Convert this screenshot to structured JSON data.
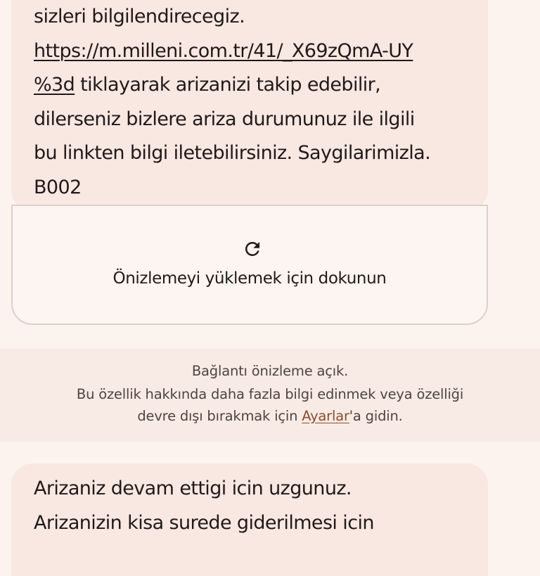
{
  "message_top": {
    "lines_before_link": [
      "sizleri bilgilendirecegiz."
    ],
    "link_part1": "https://m.milleni.com.tr/41/_X69zQmA-UY",
    "link_part2": "%3d",
    "after_link": " tiklayarak arizanizi takip edebilir,",
    "lines_after": [
      "dilerseniz bizlere ariza durumunuz ile ilgili",
      "bu linkten bilgi iletebilirsiniz.  Saygilarimizla.",
      "B002"
    ]
  },
  "preview": {
    "label": "Önizlemeyi yüklemek için dokunun",
    "icon": "reload-icon"
  },
  "link_preview_info": {
    "line1": "Bağlantı önizleme açık.",
    "line2": "Bu özellik hakkında daha fazla bilgi edinmek veya özelliği",
    "line3_before": "devre dışı bırakmak için ",
    "settings_link": "Ayarlar",
    "line3_after": "'a gidin."
  },
  "message_bottom": {
    "lines": [
      "Arizaniz devam ettigi icin uzgunuz.",
      "Arizanizin kisa surede giderilmesi icin"
    ]
  },
  "colors": {
    "background": "#fdf3ee",
    "bubble": "#f9e7e2",
    "link_accent": "#8c4e2d"
  }
}
